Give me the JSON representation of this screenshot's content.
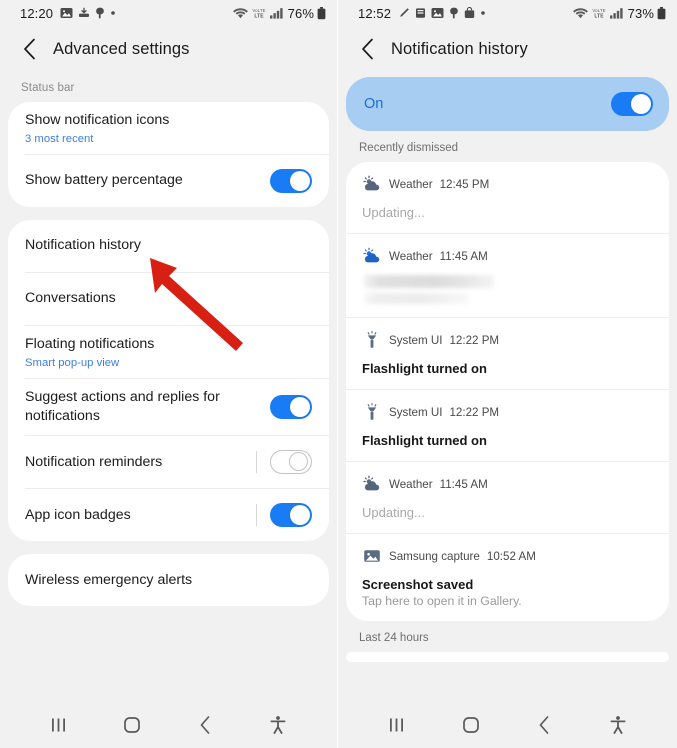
{
  "left_phone": {
    "status_bar": {
      "clock": "12:20",
      "battery_percent": "76%",
      "left_icons": [
        "image-icon",
        "download-icon",
        "app-icon",
        "dot-icon"
      ],
      "right_icons": [
        "wifi-icon",
        "volte-icon",
        "signal-icon",
        "battery-icon"
      ]
    },
    "appbar": {
      "back_label": "Back",
      "title": "Advanced settings"
    },
    "section_label": "Status bar",
    "groups": [
      {
        "rows": [
          {
            "title": "Show notification icons",
            "subtitle": "3 most recent",
            "control": "none"
          },
          {
            "title": "Show battery percentage",
            "subtitle": "",
            "control": "toggle-on"
          }
        ]
      },
      {
        "rows": [
          {
            "title": "Notification history",
            "subtitle": "",
            "control": "none"
          },
          {
            "title": "Conversations",
            "subtitle": "",
            "control": "none"
          },
          {
            "title": "Floating notifications",
            "subtitle": "Smart pop-up view",
            "control": "none"
          },
          {
            "title": "Suggest actions and replies for notifications",
            "subtitle": "",
            "control": "toggle-on"
          },
          {
            "title": "Notification reminders",
            "subtitle": "",
            "control": "toggle-off-sep"
          },
          {
            "title": "App icon badges",
            "subtitle": "",
            "control": "toggle-on-sep"
          }
        ]
      },
      {
        "rows": [
          {
            "title": "Wireless emergency alerts",
            "subtitle": "",
            "control": "none"
          }
        ]
      }
    ],
    "annotation": {
      "type": "arrow",
      "color": "#d81f14",
      "points_to": "Notification history"
    },
    "navbar": [
      "recents-icon",
      "home-icon",
      "back-icon",
      "accessibility-icon"
    ]
  },
  "right_phone": {
    "status_bar": {
      "clock": "12:52",
      "battery_percent": "73%",
      "left_icons": [
        "pencil-icon",
        "app-icon",
        "image-icon",
        "app-icon",
        "bag-icon",
        "dot-icon"
      ],
      "right_icons": [
        "wifi-icon",
        "volte-icon",
        "signal-icon",
        "battery-icon"
      ]
    },
    "appbar": {
      "back_label": "Back",
      "title": "Notification history"
    },
    "toggle_card": {
      "label": "On",
      "state": "on",
      "accent": "#1a7cf5",
      "background": "#a8cdf3"
    },
    "section_label": "Recently dismissed",
    "notifications": [
      {
        "icon": "weather-icon",
        "app": "Weather",
        "time": "12:45 PM",
        "title": "Updating...",
        "body": "",
        "style": "dim"
      },
      {
        "icon": "weather-icon",
        "app": "Weather",
        "time": "11:45 AM",
        "title": "",
        "body": "",
        "style": "redacted"
      },
      {
        "icon": "flashlight-icon",
        "app": "System UI",
        "time": "12:22 PM",
        "title": "Flashlight turned on",
        "body": "",
        "style": "normal"
      },
      {
        "icon": "flashlight-icon",
        "app": "System UI",
        "time": "12:22 PM",
        "title": "Flashlight turned on",
        "body": "",
        "style": "normal"
      },
      {
        "icon": "weather-icon",
        "app": "Weather",
        "time": "11:45 AM",
        "title": "Updating...",
        "body": "",
        "style": "dim"
      },
      {
        "icon": "image-icon",
        "app": "Samsung capture",
        "time": "10:52 AM",
        "title": "Screenshot saved",
        "body": "Tap here to open it in Gallery.",
        "style": "normal"
      }
    ],
    "footer_label": "Last 24 hours",
    "navbar": [
      "recents-icon",
      "home-icon",
      "back-icon",
      "accessibility-icon"
    ]
  }
}
